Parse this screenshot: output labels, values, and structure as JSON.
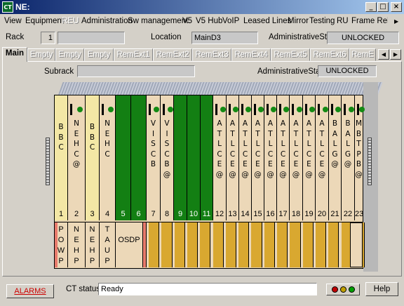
{
  "window": {
    "title": "NE:",
    "icon_text": "CT"
  },
  "menu": [
    "View",
    "Equipment",
    "REU",
    "Administration",
    "Sw management",
    "V5",
    "V5 Hub",
    "VoIP",
    "Leased Lines",
    "Mirror",
    "Testing",
    "RU",
    "Frame Relay"
  ],
  "rack_row": {
    "rack_label": "Rack",
    "rack_value": "1",
    "location_label": "Location",
    "location_value": "MainD3",
    "admin_label": "AdministrativeState",
    "admin_value": "UNLOCKED"
  },
  "tabs": [
    "Main",
    "Empty",
    "Empty",
    "Empty",
    "RemExt1",
    "RemExt2",
    "RemExt3",
    "RemExt4",
    "RemExt5",
    "RemExt6",
    "RemE"
  ],
  "subrack_row": {
    "label": "Subrack",
    "admin_label": "AdministrativeState",
    "admin_value": "UNLOCKED"
  },
  "slots": [
    {
      "num": "1",
      "text": "B\nB\nC",
      "color": "yellow"
    },
    {
      "num": "2",
      "text": "N\nE\nH\nC\n@",
      "color": "tan"
    },
    {
      "num": "3",
      "text": "B\nB\nC",
      "color": "yellow"
    },
    {
      "num": "4",
      "text": "N\nE\nH\nC",
      "color": "tan"
    },
    {
      "num": "5",
      "text": "",
      "color": "green"
    },
    {
      "num": "6",
      "text": "",
      "color": "green"
    },
    {
      "num": "7",
      "text": "V\nI\nS\nC\nB",
      "color": "tan"
    },
    {
      "num": "8",
      "text": "V\nI\nS\nC\nB\n@",
      "color": "tan"
    },
    {
      "num": "9",
      "text": "",
      "color": "green"
    },
    {
      "num": "10",
      "text": "",
      "color": "green"
    },
    {
      "num": "11",
      "text": "",
      "color": "green"
    },
    {
      "num": "12",
      "text": "A\nT\nL\nC\nE\n@",
      "color": "tan"
    },
    {
      "num": "13",
      "text": "A\nT\nL\nC\nE\n@",
      "color": "tan"
    },
    {
      "num": "14",
      "text": "A\nT\nL\nC\nE\n@",
      "color": "tan"
    },
    {
      "num": "15",
      "text": "A\nT\nL\nC\nE\n@",
      "color": "tan"
    },
    {
      "num": "16",
      "text": "A\nT\nL\nC\nE\n@",
      "color": "tan"
    },
    {
      "num": "17",
      "text": "A\nT\nL\nC\nE\n@",
      "color": "tan"
    },
    {
      "num": "18",
      "text": "A\nT\nL\nC\nE\n@",
      "color": "tan"
    },
    {
      "num": "19",
      "text": "A\nT\nL\nC\nE\n@",
      "color": "tan"
    },
    {
      "num": "20",
      "text": "A\nT\nL\nC\nE\n@",
      "color": "tan"
    },
    {
      "num": "21",
      "text": "B\nA\nL\nG\n@",
      "color": "tan"
    },
    {
      "num": "22",
      "text": "B\nA\nL\nG\n@",
      "color": "tan"
    },
    {
      "num": "23",
      "text": "M\nB\nT\nP\nB\n@",
      "color": "tan"
    }
  ],
  "power": [
    {
      "text": "P\nO\nW\nP"
    },
    {
      "text": "N\nE\nH\nP"
    },
    {
      "text": "N\nE\nH\nP"
    },
    {
      "text": "T\nA\nU\nP"
    },
    {
      "text": "OSDP"
    }
  ],
  "status": {
    "alarms_label": "ALARMS",
    "ct_status_label": "CT status",
    "ct_status_value": "Ready",
    "help_label": "Help"
  },
  "colors": {
    "yellow": "#f3e7a5",
    "green": "#137f13",
    "tan": "#ecd8b8",
    "orange": "#d9a830",
    "red": "#e87a6c"
  }
}
